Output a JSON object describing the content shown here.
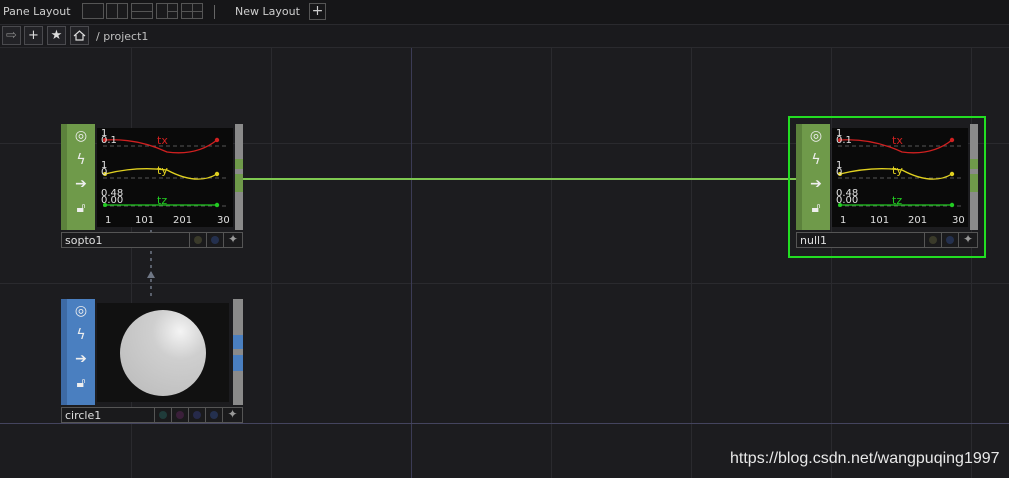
{
  "topbar": {
    "pane_layout_label": "Pane Layout",
    "new_layout_label": "New Layout",
    "add_label": "+"
  },
  "pathbar": {
    "path": "/ project1",
    "back_icon": "arrow-right-icon",
    "add_icon": "plus-icon",
    "favorite_icon": "star-icon",
    "home_icon": "home-icon"
  },
  "nodes": {
    "sopto1": {
      "name": "sopto1",
      "strip_color": "#6f9a4a",
      "channels": [
        {
          "name": "tx",
          "color": "#d02020",
          "top": "1",
          "bottom": "0.1"
        },
        {
          "name": "ty",
          "color": "#e0d020",
          "top": "1",
          "bottom": "0"
        },
        {
          "name": "tz",
          "color": "#22cc22",
          "top": "0.48",
          "bottom": "0.00"
        }
      ],
      "axis_ticks": [
        "1",
        "101",
        "201",
        "30"
      ]
    },
    "null1": {
      "name": "null1",
      "strip_color": "#6f9a4a",
      "selected_color": "#22dd22",
      "channels": [
        {
          "name": "tx",
          "color": "#d02020",
          "top": "1",
          "bottom": "0.1"
        },
        {
          "name": "ty",
          "color": "#e0d020",
          "top": "1",
          "bottom": "0"
        },
        {
          "name": "tz",
          "color": "#22cc22",
          "top": "0.48",
          "bottom": "0.00"
        }
      ],
      "axis_ticks": [
        "1",
        "101",
        "201",
        "30"
      ]
    },
    "circle1": {
      "name": "circle1",
      "strip_color": "#4a7fc0"
    }
  },
  "wire_color": "#7ec850",
  "watermark": "https://blog.csdn.net/wangpuqing1997"
}
